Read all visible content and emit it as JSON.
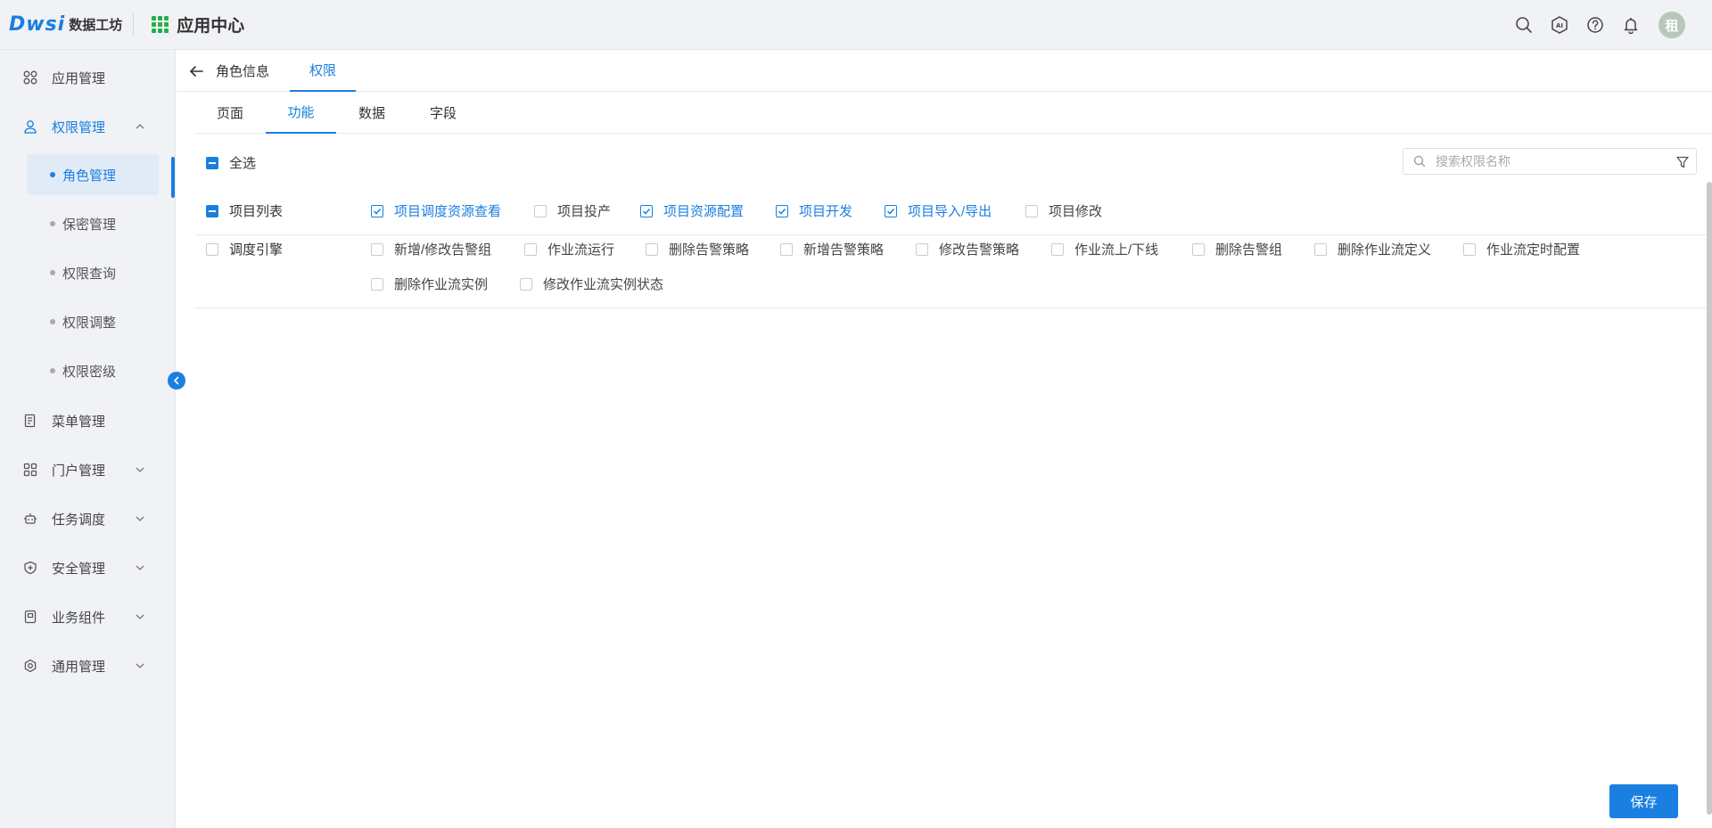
{
  "header": {
    "logo_mark": "Dwsi",
    "logo_text": "数据工坊",
    "app_center": "应用中心",
    "ai_label": "AI",
    "avatar_text": "租"
  },
  "sidebar": {
    "items": [
      {
        "label": "应用管理"
      },
      {
        "label": "权限管理"
      },
      {
        "label": "菜单管理"
      },
      {
        "label": "门户管理"
      },
      {
        "label": "任务调度"
      },
      {
        "label": "安全管理"
      },
      {
        "label": "业务组件"
      },
      {
        "label": "通用管理"
      }
    ],
    "sub_items": [
      {
        "label": "角色管理"
      },
      {
        "label": "保密管理"
      },
      {
        "label": "权限查询"
      },
      {
        "label": "权限调整"
      },
      {
        "label": "权限密级"
      }
    ]
  },
  "top_tabs": [
    {
      "label": "角色信息"
    },
    {
      "label": "权限"
    }
  ],
  "sub_tabs": [
    {
      "label": "页面"
    },
    {
      "label": "功能"
    },
    {
      "label": "数据"
    },
    {
      "label": "字段"
    }
  ],
  "select_all": {
    "label": "全选",
    "state": "indeterminate"
  },
  "search": {
    "placeholder": "搜索权限名称",
    "value": ""
  },
  "groups": [
    {
      "name": "项目列表",
      "state": "indeterminate",
      "items": [
        {
          "label": "项目调度资源查看",
          "checked": true
        },
        {
          "label": "项目投产",
          "checked": false
        },
        {
          "label": "项目资源配置",
          "checked": true
        },
        {
          "label": "项目开发",
          "checked": true
        },
        {
          "label": "项目导入/导出",
          "checked": true
        },
        {
          "label": "项目修改",
          "checked": false
        }
      ]
    },
    {
      "name": "调度引擎",
      "state": "unchecked",
      "items": [
        {
          "label": "新增/修改告警组",
          "checked": false
        },
        {
          "label": "作业流运行",
          "checked": false
        },
        {
          "label": "删除告警策略",
          "checked": false
        },
        {
          "label": "新增告警策略",
          "checked": false
        },
        {
          "label": "修改告警策略",
          "checked": false
        },
        {
          "label": "作业流上/下线",
          "checked": false
        },
        {
          "label": "删除告警组",
          "checked": false
        },
        {
          "label": "删除作业流定义",
          "checked": false
        },
        {
          "label": "作业流定时配置",
          "checked": false
        },
        {
          "label": "删除作业流实例",
          "checked": false
        },
        {
          "label": "修改作业流实例状态",
          "checked": false
        }
      ]
    }
  ],
  "save_label": "保存",
  "colors": {
    "accent": "#1a7fe0",
    "logo_green": "#22b14c"
  }
}
